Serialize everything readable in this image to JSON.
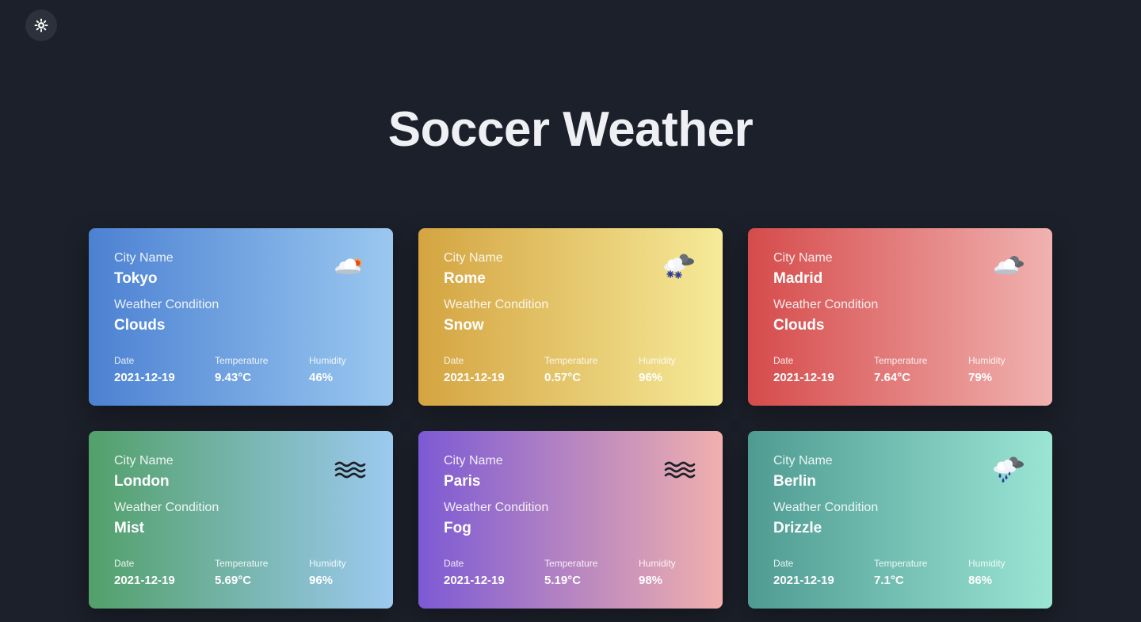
{
  "header": {
    "title": "Soccer Weather",
    "theme_toggle_icon": "sun-icon"
  },
  "labels": {
    "city": "City Name",
    "condition": "Weather Condition",
    "date": "Date",
    "temperature": "Temperature",
    "humidity": "Humidity"
  },
  "cards": [
    {
      "city": "Tokyo",
      "condition": "Clouds",
      "date": "2021-12-19",
      "temperature": "9.43°C",
      "humidity": "46%",
      "icon": "cloud-sun-icon",
      "gradient": [
        "#4c81d2",
        "#9ac8f0"
      ]
    },
    {
      "city": "Rome",
      "condition": "Snow",
      "date": "2021-12-19",
      "temperature": "0.57°C",
      "humidity": "96%",
      "icon": "snow-cloud-icon",
      "gradient": [
        "#d4a441",
        "#f6ea99"
      ]
    },
    {
      "city": "Madrid",
      "condition": "Clouds",
      "date": "2021-12-19",
      "temperature": "7.64°C",
      "humidity": "79%",
      "icon": "cloud-icon",
      "gradient": [
        "#d64b4b",
        "#f0b2b0"
      ]
    },
    {
      "city": "London",
      "condition": "Mist",
      "date": "2021-12-19",
      "temperature": "5.69°C",
      "humidity": "96%",
      "icon": "mist-icon",
      "gradient": [
        "#52a06a",
        "#9ccaf0"
      ]
    },
    {
      "city": "Paris",
      "condition": "Fog",
      "date": "2021-12-19",
      "temperature": "5.19°C",
      "humidity": "98%",
      "icon": "fog-icon",
      "gradient": [
        "#7c5ad4",
        "#f0b0ae"
      ]
    },
    {
      "city": "Berlin",
      "condition": "Drizzle",
      "date": "2021-12-19",
      "temperature": "7.1°C",
      "humidity": "86%",
      "icon": "rain-cloud-icon",
      "gradient": [
        "#4f9b92",
        "#9be5d5"
      ]
    }
  ]
}
